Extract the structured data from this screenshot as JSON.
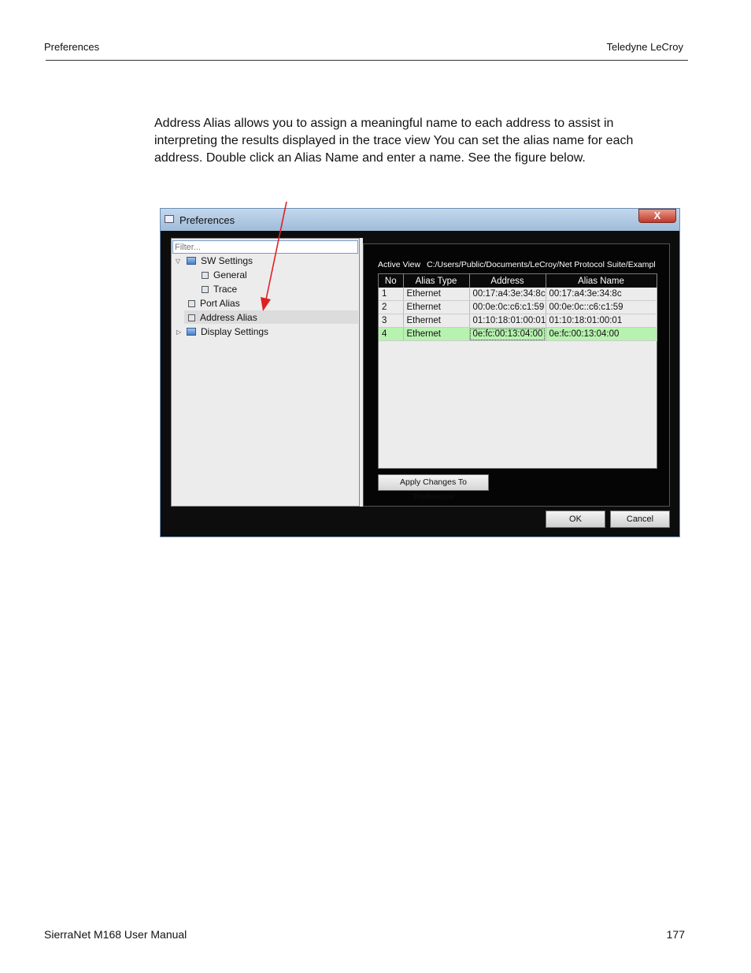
{
  "header": {
    "left": "Preferences",
    "right": "Teledyne LeCroy"
  },
  "body": {
    "lines": [
      "Address Alias allows you to assign a meaningful name to each address to assist in",
      "interpreting the results displayed in the trace view You can set the alias name for each",
      "address. Double click an Alias Name and enter a name. See the figure below."
    ]
  },
  "window": {
    "title": "Preferences",
    "close": "X",
    "filter_placeholder": "Filter...",
    "tree": {
      "sw_settings": "SW Settings",
      "general": "General",
      "trace": "Trace",
      "port_alias": "Port Alias",
      "address_alias": "Address Alias",
      "display_settings": "Display Settings"
    },
    "active_view_label": "Active View",
    "active_view_path": "C:/Users/Public/Documents/LeCroy/Net Protocol Suite/Exampl",
    "columns": [
      "No",
      "Alias Type",
      "Address",
      "Alias Name"
    ],
    "rows": [
      {
        "no": "1",
        "type": "Ethernet",
        "address": "00:17:a4:3e:34:8c",
        "alias": "00:17:a4:3e:34:8c"
      },
      {
        "no": "2",
        "type": "Ethernet",
        "address": "00:0e:0c:c6:c1:59",
        "alias": "00:0e:0c::c6:c1:59"
      },
      {
        "no": "3",
        "type": "Ethernet",
        "address": "01:10:18:01:00:01",
        "alias": "01:10:18:01:00:01"
      },
      {
        "no": "4",
        "type": "Ethernet",
        "address": "0e:fc:00:13:04:00",
        "alias": "0e:fc:00:13:04:00"
      }
    ],
    "apply_label": "Apply Changes To Preference",
    "ok_label": "OK",
    "cancel_label": "Cancel"
  },
  "colors": {
    "arrow": "#e02020",
    "selected_row": "#b7f2b0"
  },
  "footer": {
    "left": "SierraNet M168 User Manual",
    "right": "177"
  }
}
